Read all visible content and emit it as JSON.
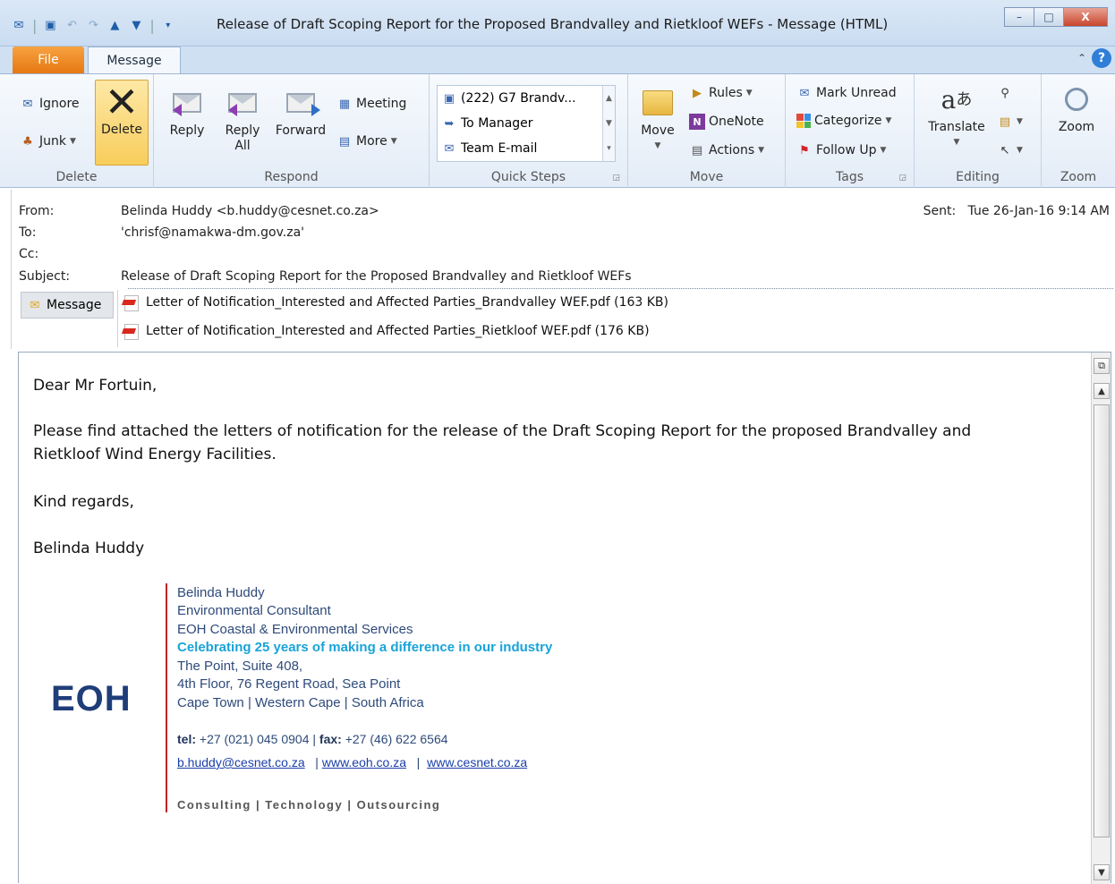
{
  "window": {
    "title": "Release of Draft Scoping Report for the Proposed Brandvalley and Rietkloof WEFs  -  Message (HTML)",
    "minimize": "–",
    "maximize": "□",
    "close": "X"
  },
  "tabs": {
    "file": "File",
    "message": "Message"
  },
  "ribbon": {
    "delete_group": {
      "label": "Delete",
      "ignore": "Ignore",
      "junk": "Junk",
      "delete": "Delete"
    },
    "respond_group": {
      "label": "Respond",
      "reply": "Reply",
      "reply_all_1": "Reply",
      "reply_all_2": "All",
      "forward": "Forward",
      "meeting": "Meeting",
      "more": "More"
    },
    "quicksteps_group": {
      "label": "Quick Steps",
      "items": [
        "(222) G7 Brandv...",
        "To Manager",
        "Team E-mail"
      ]
    },
    "move_group": {
      "label": "Move",
      "move": "Move",
      "rules": "Rules",
      "onenote": "OneNote",
      "actions": "Actions"
    },
    "tags_group": {
      "label": "Tags",
      "mark_unread": "Mark Unread",
      "categorize": "Categorize",
      "follow_up": "Follow Up"
    },
    "editing_group": {
      "label": "Editing",
      "translate": "Translate"
    },
    "zoom_group": {
      "label": "Zoom",
      "zoom": "Zoom"
    }
  },
  "header": {
    "from_label": "From:",
    "from_value": "Belinda Huddy <b.huddy@cesnet.co.za>",
    "to_label": "To:",
    "to_value": "'chrisf@namakwa-dm.gov.za'",
    "cc_label": "Cc:",
    "subject_label": "Subject:",
    "subject_value": "Release of Draft Scoping Report for the Proposed Brandvalley and Rietkloof WEFs",
    "sent_label": "Sent:",
    "sent_value": "Tue 26-Jan-16 9:14 AM",
    "message_tab": "Message",
    "attachments": [
      "Letter of Notification_Interested and Affected Parties_Brandvalley WEF.pdf (163 KB)",
      "Letter of Notification_Interested and Affected Parties_Rietkloof WEF.pdf (176 KB)"
    ]
  },
  "body": {
    "greeting": "Dear Mr Fortuin,",
    "paragraph_1": "Please find attached the letters of notification for the release of the Draft Scoping Report for the proposed Brandvalley and",
    "paragraph_2": "Rietkloof Wind Energy Facilities.",
    "closing": "Kind regards,",
    "sender": "Belinda Huddy"
  },
  "signature": {
    "logo": "EOH",
    "name": "Belinda Huddy",
    "role": "Environmental Consultant",
    "company": "EOH Coastal & Environmental Services",
    "tagline": "Celebrating 25 years of making a difference in our industry",
    "address_1": "The Point, Suite 408,",
    "address_2": "4th Floor, 76 Regent Road, Sea Point",
    "address_3": "Cape Town  | Western Cape  |  South Africa",
    "tel_label": "tel:",
    "tel_value": "+27 (021) 045 0904",
    "fax_label": "fax:",
    "fax_value": "+27 (46) 622 6564",
    "email": "b.huddy@cesnet.co.za",
    "web_1": "www.eoh.co.za",
    "web_2": "www.cesnet.co.za",
    "footer": "Consulting | Technology | Outsourcing"
  },
  "colors": {
    "accent": "#f7a240",
    "signature_cyan": "#19a3d8",
    "signature_red_line": "#c0242a",
    "logo_blue": "#1f3d78"
  }
}
